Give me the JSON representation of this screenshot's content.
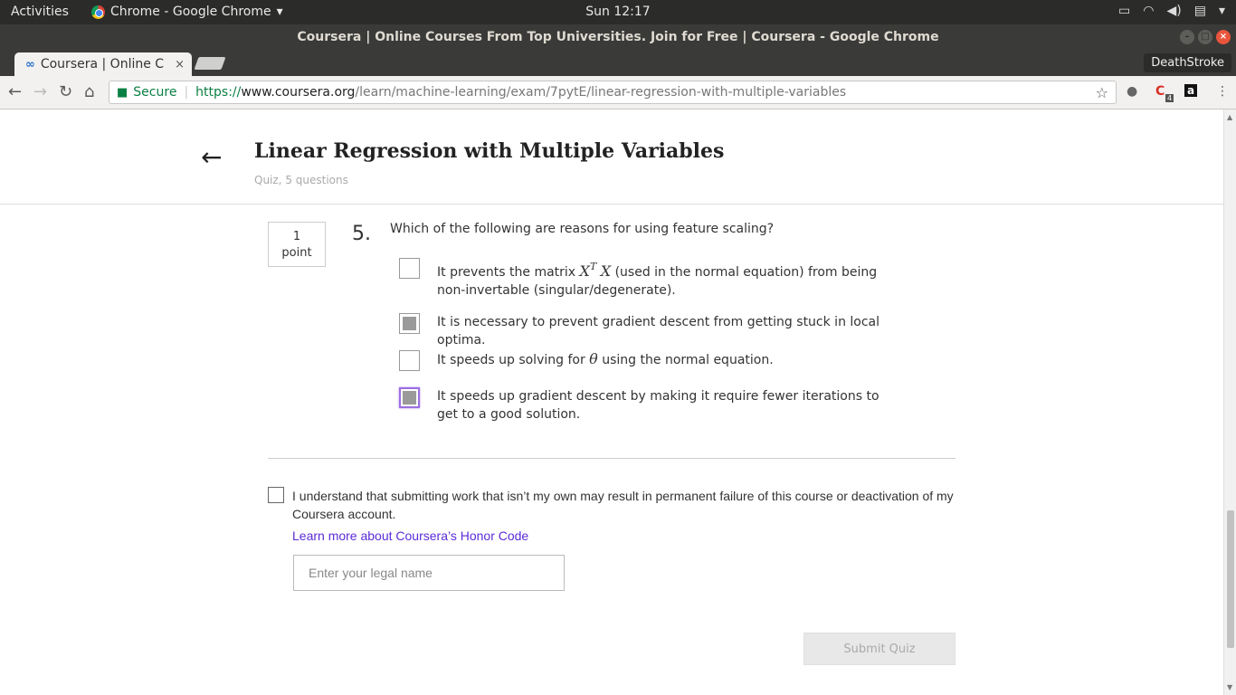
{
  "topbar": {
    "activities": "Activities",
    "app_name": "Chrome - Google Chrome",
    "app_caret": "▾",
    "clock": "Sun 12:17"
  },
  "window": {
    "title": "Coursera | Online Courses From Top Universities. Join for Free | Coursera - Google Chrome"
  },
  "tab": {
    "favicon": "∞",
    "title": "Coursera | Online C",
    "close": "×"
  },
  "profile": {
    "name": "DeathStroke"
  },
  "omnibox": {
    "secure_label": "Secure",
    "url_scheme": "https://",
    "url_host": "www.coursera.org",
    "url_path": "/learn/machine-learning/exam/7pytE/linear-regression-with-multiple-variables"
  },
  "extensions": {
    "badge_count": "4"
  },
  "quiz": {
    "title": "Linear Regression with Multiple Variables",
    "subtitle": "Quiz, 5 questions"
  },
  "question": {
    "points_value": "1",
    "points_label": "point",
    "number": "5.",
    "text": "Which of the following are reasons for using feature scaling?",
    "options": [
      {
        "text_before": "It prevents the matrix ",
        "math_x1": "X",
        "math_sup": "T",
        "math_x2": "X",
        "text_after": " (used in the normal equation) from being non-invertable (singular/degenerate).",
        "checked": false
      },
      {
        "label": "It is necessary to prevent gradient descent from getting stuck in local optima.",
        "checked": true
      },
      {
        "text_before": "It speeds up solving for ",
        "math_theta": "θ",
        "text_after": " using the normal equation.",
        "checked": false
      },
      {
        "label": "It speeds up gradient descent by making it require fewer iterations to get to a good solution.",
        "checked": true
      }
    ]
  },
  "honor": {
    "statement": "I understand that submitting work that isn’t my own may result in permanent failure of this course or deactivation of my Coursera account.",
    "link": "Learn more about Coursera’s Honor Code",
    "name_placeholder": "Enter your legal name",
    "name_value": ""
  },
  "submit": {
    "label": "Submit Quiz"
  }
}
